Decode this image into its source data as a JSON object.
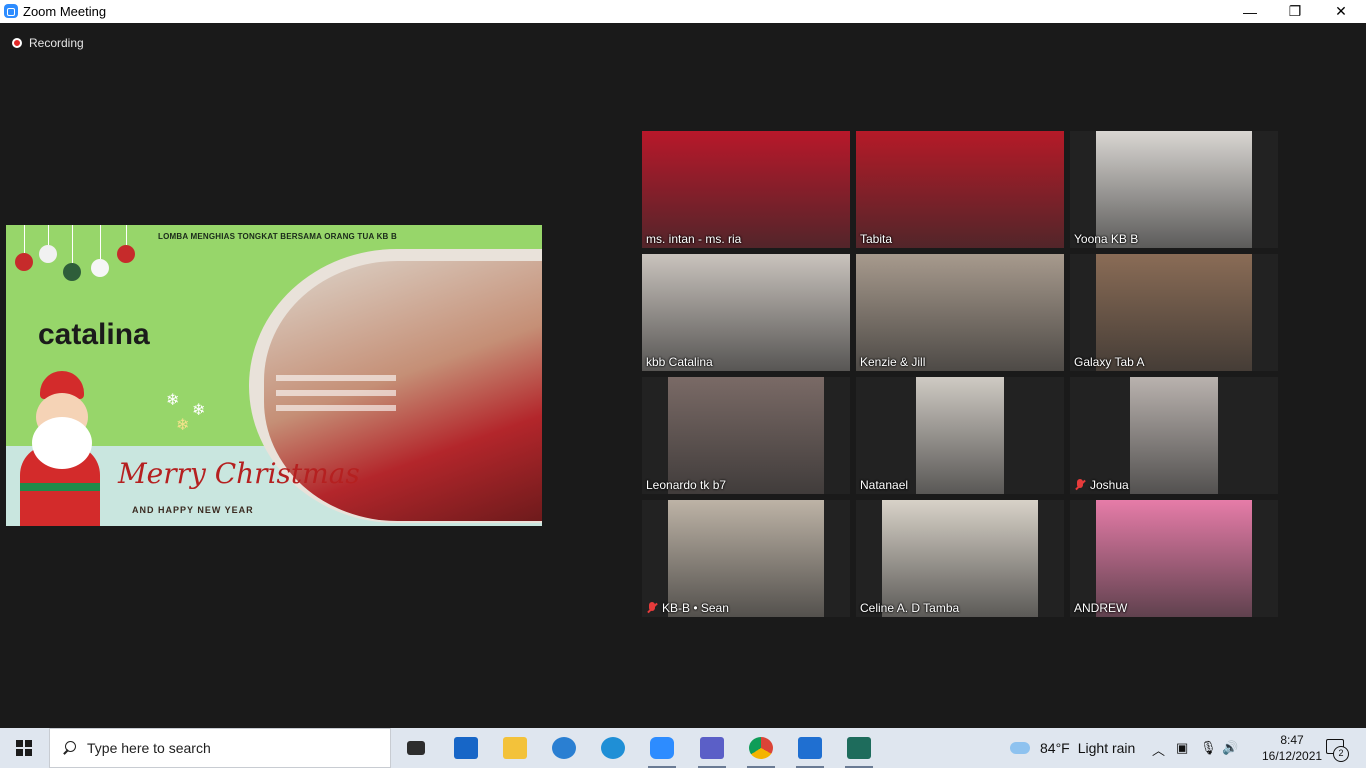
{
  "window": {
    "title": "Zoom Meeting",
    "minimize": "—",
    "restore": "❐",
    "close": "✕"
  },
  "recording": {
    "label": "Recording"
  },
  "share": {
    "heading": "LOMBA MENGHIAS TONGKAT  BERSAMA ORANG TUA  KB B",
    "name": "catalina",
    "greeting": "Merry Christmas",
    "subgreeting": "AND HAPPY NEW YEAR"
  },
  "gallery": [
    {
      "name": "ms. intan - ms. ria",
      "muted": false,
      "active": true,
      "bg": "#b8182a"
    },
    {
      "name": "Tabita",
      "muted": false,
      "active": false,
      "bg": "#b51a28"
    },
    {
      "name": "Yoona KB B",
      "muted": false,
      "active": false,
      "bg": "#d9d6d2"
    },
    {
      "name": "kbb Catalina",
      "muted": false,
      "active": false,
      "bg": "#c9c3bd"
    },
    {
      "name": "Kenzie & Jill",
      "muted": false,
      "active": false,
      "bg": "#a79a8d"
    },
    {
      "name": "Galaxy Tab A",
      "muted": false,
      "active": false,
      "bg": "#8a6c56"
    },
    {
      "name": "Leonardo tk b7",
      "muted": false,
      "active": false,
      "bg": "#7a6a66"
    },
    {
      "name": "Natanael",
      "muted": false,
      "active": false,
      "bg": "#cfcac3"
    },
    {
      "name": "Joshua",
      "muted": true,
      "active": false,
      "bg": "#b9b2ae"
    },
    {
      "name": "KB-B • Sean",
      "muted": true,
      "active": false,
      "bg": "#bdb3a6"
    },
    {
      "name": "Celine A. D Tamba",
      "muted": false,
      "active": false,
      "bg": "#d8d2c8"
    },
    {
      "name": "ANDREW",
      "muted": false,
      "active": false,
      "bg": "#e67ca8"
    }
  ],
  "taskbar": {
    "search_placeholder": "Type here to search",
    "apps": [
      {
        "icon": "task-view-icon",
        "color": "#2d2d2d"
      },
      {
        "icon": "mail-icon",
        "color": "#1766c7"
      },
      {
        "icon": "file-explorer-icon",
        "color": "#f3c23a"
      },
      {
        "icon": "vpn-icon",
        "color": "#2a7fd2"
      },
      {
        "icon": "edge-icon",
        "color": "#1f8fd6"
      },
      {
        "icon": "zoom-icon",
        "color": "#2D8CFF"
      },
      {
        "icon": "teams-icon",
        "color": "#5b5fc7"
      },
      {
        "icon": "chrome-icon",
        "color": "#db4437"
      },
      {
        "icon": "presentation-icon",
        "color": "#1f6fd1"
      },
      {
        "icon": "filmora-icon",
        "color": "#1e6c5c"
      }
    ],
    "weather": {
      "temp": "84°F",
      "condition": "Light rain"
    },
    "time": "8:47",
    "date": "16/12/2021",
    "notifications": "2"
  }
}
